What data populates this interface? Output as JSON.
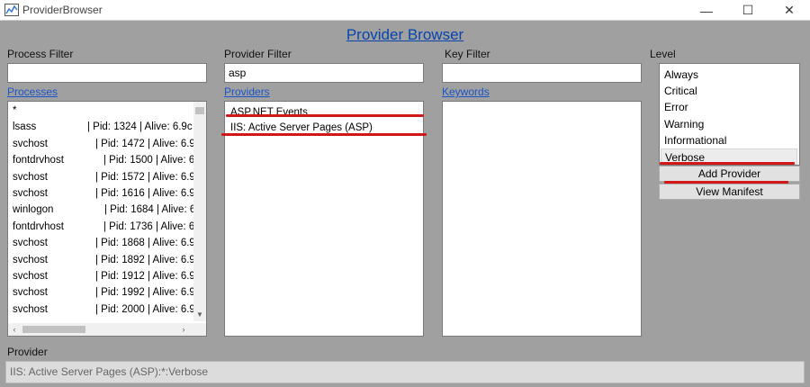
{
  "window": {
    "title": "ProviderBrowser",
    "min_glyph": "—",
    "max_glyph": "☐",
    "close_glyph": "✕"
  },
  "page_title": "Provider Browser",
  "process_filter": {
    "label": "Process Filter",
    "value": "",
    "link": "Processes"
  },
  "provider_filter": {
    "label": "Provider Filter",
    "value": "asp",
    "link": "Providers"
  },
  "key_filter": {
    "label": "Key Filter",
    "value": "",
    "link": "Keywords"
  },
  "level": {
    "label": "Level"
  },
  "processes": [
    {
      "name": "*",
      "info": ""
    },
    {
      "name": "lsass",
      "info": "| Pid:  1324 | Alive:  6.9c"
    },
    {
      "name": "svchost",
      "info": "| Pid:  1472 | Alive:  6.9"
    },
    {
      "name": "fontdrvhost",
      "info": "| Pid:  1500 | Alive:  6"
    },
    {
      "name": "svchost",
      "info": "| Pid:  1572 | Alive:  6.9"
    },
    {
      "name": "svchost",
      "info": "| Pid:  1616 | Alive:  6.9"
    },
    {
      "name": "winlogon",
      "info": "| Pid:  1684 | Alive:  6"
    },
    {
      "name": "fontdrvhost",
      "info": "| Pid:  1736 | Alive:  6"
    },
    {
      "name": "svchost",
      "info": "| Pid:  1868 | Alive:  6.9"
    },
    {
      "name": "svchost",
      "info": "| Pid:  1892 | Alive:  6.9"
    },
    {
      "name": "svchost",
      "info": "| Pid:  1912 | Alive:  6.9"
    },
    {
      "name": "svchost",
      "info": "| Pid:  1992 | Alive:  6.9"
    },
    {
      "name": "svchost",
      "info": "| Pid:  2000 | Alive:  6.9"
    }
  ],
  "providers": [
    "ASP.NET Events",
    "IIS: Active Server Pages (ASP)"
  ],
  "levels": [
    "Always",
    "Critical",
    "Error",
    "Warning",
    "Informational",
    "Verbose"
  ],
  "selected_level": "Verbose",
  "buttons": {
    "add_provider": "Add Provider",
    "view_manifest": "View Manifest"
  },
  "provider": {
    "label": "Provider",
    "value": "IIS: Active Server Pages (ASP):*:Verbose"
  },
  "colors": {
    "link": "#1a55c9",
    "highlight_line": "#d01818",
    "background": "#a0a0a0"
  },
  "icons": {
    "app": "chart-icon",
    "scroll_down": "chevron-down-icon",
    "scroll_left": "chevron-left-icon",
    "scroll_right": "chevron-right-icon"
  }
}
